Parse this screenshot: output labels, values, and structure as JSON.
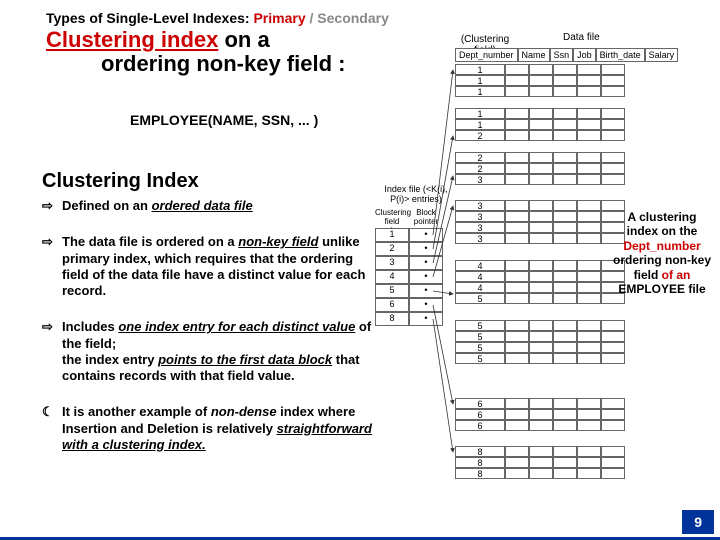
{
  "header": {
    "prefix": "Types of Single-Level Indexes:",
    "primary": "Primary",
    "sep": " / ",
    "secondary": "Secondary"
  },
  "subtitle": {
    "l1a": "Clustering index",
    "l1b": " on a",
    "l2": "         ordering non-key field :"
  },
  "schema": "EMPLOYEE(NAME, SSN, ... )",
  "section": "Clustering Index",
  "bullets": [
    {
      "glyph": "⇨",
      "html": "Defined on an <span class='ital'>ordered data file</span>"
    },
    {
      "glyph": "⇨",
      "html": "The data file is ordered on a <span class='ital'>non-key field</span> unlike primary index, which requires that the ordering field of the data file have a distinct value for each record."
    },
    {
      "glyph": "⇨",
      "html": "Includes <span class='ital'>one index entry for each distinct value</span> of the field;<br>the index entry <span class='ital'>points to the first data block</span> that contains records with that field value."
    },
    {
      "glyph": "☾",
      "html": "It is another example of <span class='ital-nou'>non-dense</span> index where Insertion and Deletion is relatively <span class='ital'>straightforward with a clustering index.</span>"
    }
  ],
  "figure": {
    "clust_field_label": "(Clustering field)",
    "data_file_label": "Data file",
    "headers": [
      "Dept_number",
      "Name",
      "Ssn",
      "Job",
      "Birth_date",
      "Salary"
    ],
    "groups": [
      {
        "key": "1",
        "rows": 3
      },
      {
        "key": "1",
        "rows": 3,
        "extra": [
          "2"
        ]
      },
      {
        "key": "2",
        "rows": 3,
        "vals": [
          "2",
          "2",
          "3"
        ]
      },
      {
        "key": "3",
        "rows": 4,
        "vals": [
          "3",
          "3",
          "3",
          "3"
        ]
      },
      {
        "key": "4",
        "rows": 4,
        "vals": [
          "4",
          "4",
          "4",
          "5"
        ]
      },
      {
        "key": "5",
        "rows": 4,
        "vals": [
          "5",
          "5",
          "5",
          "5"
        ]
      },
      {
        "key": "6",
        "rows": 3,
        "vals": [
          "6",
          "6",
          "6"
        ]
      },
      {
        "key": "8",
        "rows": 3,
        "vals": [
          "8",
          "8",
          "8"
        ]
      }
    ],
    "index_label": "Index file (<K(i), P(i)> entries)",
    "index_headers": [
      "Clustering field value",
      "Block pointer"
    ],
    "index": [
      "1",
      "2",
      "3",
      "4",
      "5",
      "6",
      "8"
    ]
  },
  "caption": {
    "l1": "A clustering index on the ",
    "l2": "Dept_number",
    "l3": " ordering non-key field ",
    "l4": "of an",
    "l5": " EMPLOYEE file"
  },
  "page": "9"
}
